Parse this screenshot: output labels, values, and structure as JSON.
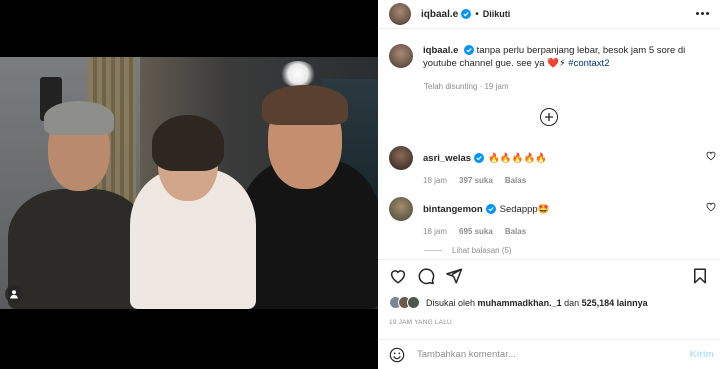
{
  "post": {
    "username": "iqbaal.e",
    "follow_state": "Diikuti",
    "separator": "•"
  },
  "caption": {
    "username": "iqbaal.e",
    "text": "tanpa perlu berpanjang lebar, besok jam 5 sore di youtube channel gue. see ya",
    "hashtag": "#contaxt2",
    "edited": "Telah disunting",
    "time": "19 jam"
  },
  "comments": [
    {
      "username": "asri_welas",
      "text": "🔥🔥🔥🔥🔥",
      "time": "18 jam",
      "likes": "397 suka",
      "reply": "Balas"
    },
    {
      "username": "bintangemon",
      "text": "Sedappp🤩",
      "time": "18 jam",
      "likes": "695 suka",
      "reply": "Balas"
    }
  ],
  "view_replies": "Lihat balasan (5)",
  "likes": {
    "prefix": "Disukai oleh",
    "user": "muhammadkhan._1",
    "conj": "dan",
    "count": "525,184 lainnya"
  },
  "timeago": "19 JAM YANG LALU",
  "comment_box": {
    "placeholder": "Tambahkan komentar...",
    "post_label": "Kirim"
  },
  "colors": {
    "verified": "#0095f6",
    "link": "#00376b",
    "post_disabled": "#b2dffc"
  }
}
